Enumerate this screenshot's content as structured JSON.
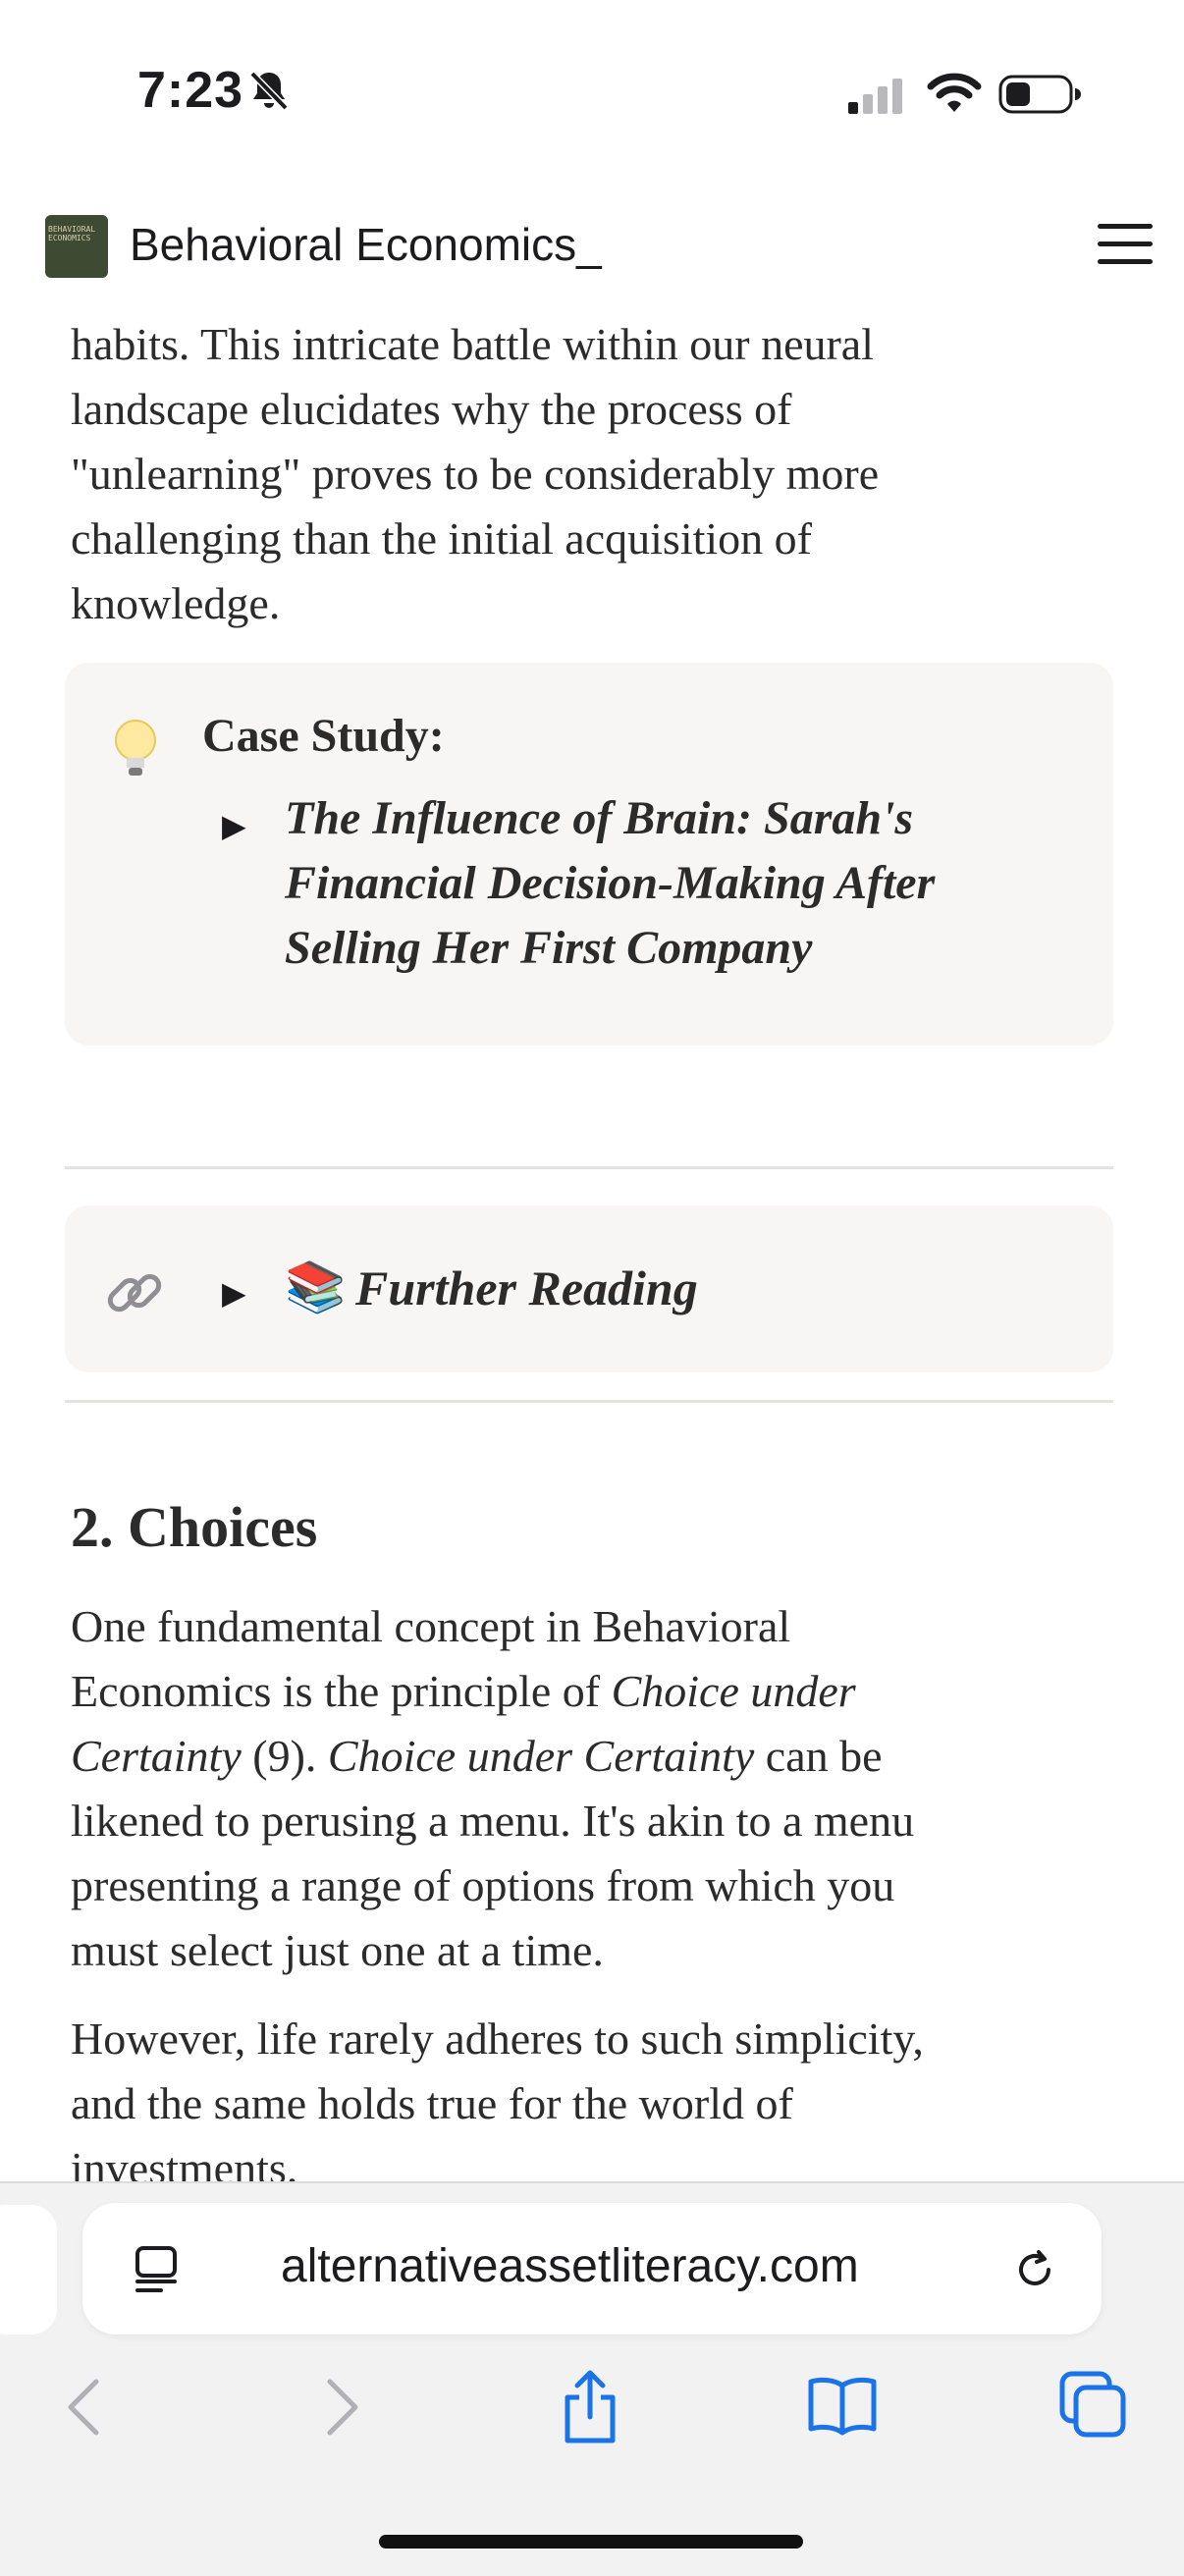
{
  "status": {
    "time": "7:23"
  },
  "header": {
    "title": "Behavioral Economics_",
    "logo_text": "BEHAVIORAL ECONOMICS"
  },
  "article": {
    "intro_lines": [
      "habits. This intricate battle within our neural",
      "landscape elucidates why the process of",
      "\"unlearning\" proves to be considerably more",
      "challenging than the initial acquisition of",
      "knowledge."
    ],
    "case_study": {
      "label": "Case Study:",
      "title_lines": [
        "The Influence of Brain: Sarah's",
        "Financial Decision-Making After",
        "Selling Her First Company"
      ]
    },
    "further_reading": {
      "emoji": "📚",
      "label": "Further Reading"
    },
    "section": {
      "heading": "2. Choices",
      "p1": {
        "l1": "One fundamental concept in Behavioral",
        "l2a": "Economics is the principle of ",
        "l2b": "Choice under",
        "l3a": "Certainty",
        "l3b": " (9).  ",
        "l3c": "Choice under Certainty",
        "l3d": " can be",
        "l4": "likened to perusing a menu. It's akin to a menu",
        "l5": "presenting a range of options from which you",
        "l6": "must select just one at a time."
      },
      "p2_lines": [
        "However, life rarely adheres to such simplicity,",
        "and the same holds true for the world of",
        "investments."
      ]
    }
  },
  "browser": {
    "url": "alternativeassetliteracy.com"
  }
}
